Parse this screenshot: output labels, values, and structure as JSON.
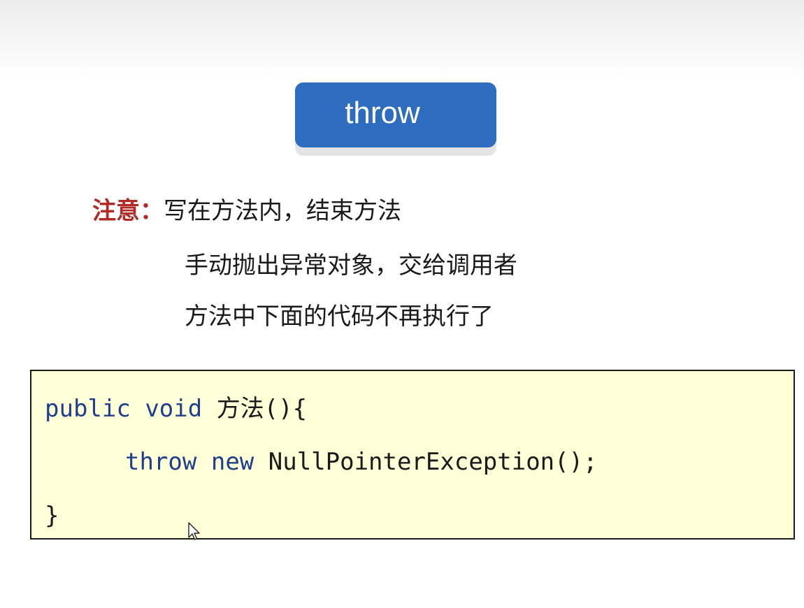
{
  "slide": {
    "title": "throw",
    "note": {
      "label": "注意：",
      "lines": [
        "写在方法内，结束方法",
        "手动抛出异常对象，交给调用者",
        "方法中下面的代码不再执行了"
      ]
    },
    "code": {
      "line1": {
        "kw_public": "public",
        "kw_void": "void",
        "rest": "方法(){"
      },
      "line2": {
        "kw_throw": "throw",
        "kw_new": "new",
        "rest": "NullPointerException();"
      },
      "line3": "}"
    }
  },
  "colors": {
    "title_bg": "#2e6cbf",
    "note_label": "#b02a26",
    "keyword": "#1f3e8c",
    "code_bg": "#ffffd8"
  },
  "icons": {
    "cursor": "mouse-pointer-icon"
  }
}
